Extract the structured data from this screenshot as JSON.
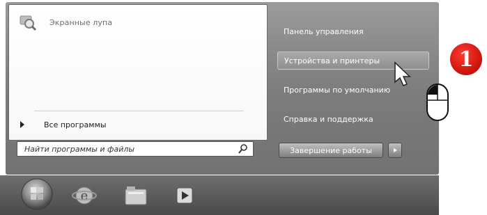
{
  "start_menu": {
    "pinned": [
      {
        "label": "Экранные лупа",
        "icon": "magnifier-app-icon"
      }
    ],
    "all_programs_label": "Все программы",
    "search": {
      "placeholder": "Найти программы и файлы",
      "value": ""
    },
    "right_items": [
      {
        "label": "Панель управления",
        "highlighted": false
      },
      {
        "label": "Устройства и принтеры",
        "highlighted": true
      },
      {
        "label": "Программы по умолчанию",
        "highlighted": false
      },
      {
        "label": "Справка и поддержка",
        "highlighted": false
      }
    ],
    "shutdown_label": "Завершение работы"
  },
  "taskbar": {
    "items": [
      {
        "name": "start-orb",
        "icon": "windows-orb-icon"
      },
      {
        "name": "internet-explorer",
        "icon": "ie-icon"
      },
      {
        "name": "file-explorer",
        "icon": "folder-icon"
      },
      {
        "name": "media-player",
        "icon": "play-icon"
      }
    ]
  },
  "annotation": {
    "step_number": "1",
    "badge_color": "#d41a12"
  }
}
